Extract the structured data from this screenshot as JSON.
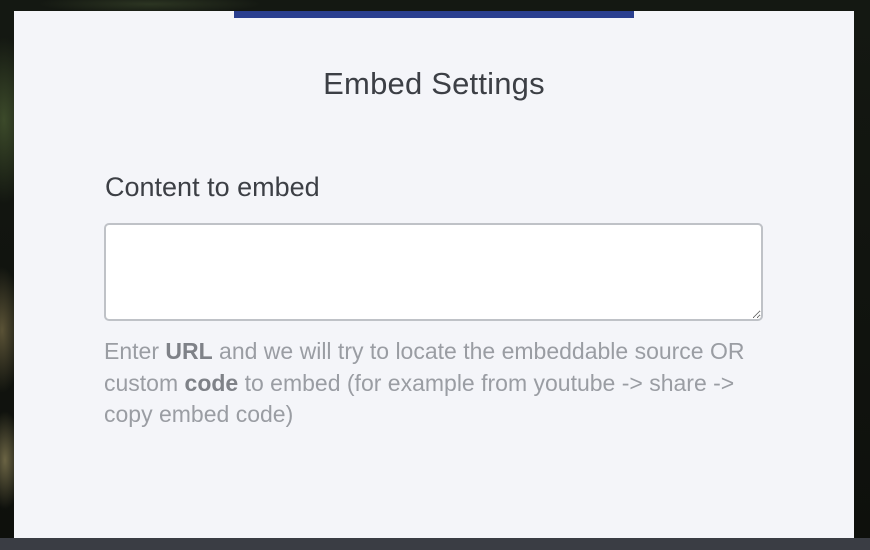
{
  "modal": {
    "title": "Embed Settings",
    "accent_color": "#2a3f8f",
    "field_label": "Content to embed",
    "input_value": "",
    "help": {
      "part1": "Enter ",
      "bold1": "URL",
      "part2": " and we will try to locate the embeddable source OR custom ",
      "bold2": "code",
      "part3": " to embed (for example from youtube -> share -> copy embed code)"
    }
  }
}
